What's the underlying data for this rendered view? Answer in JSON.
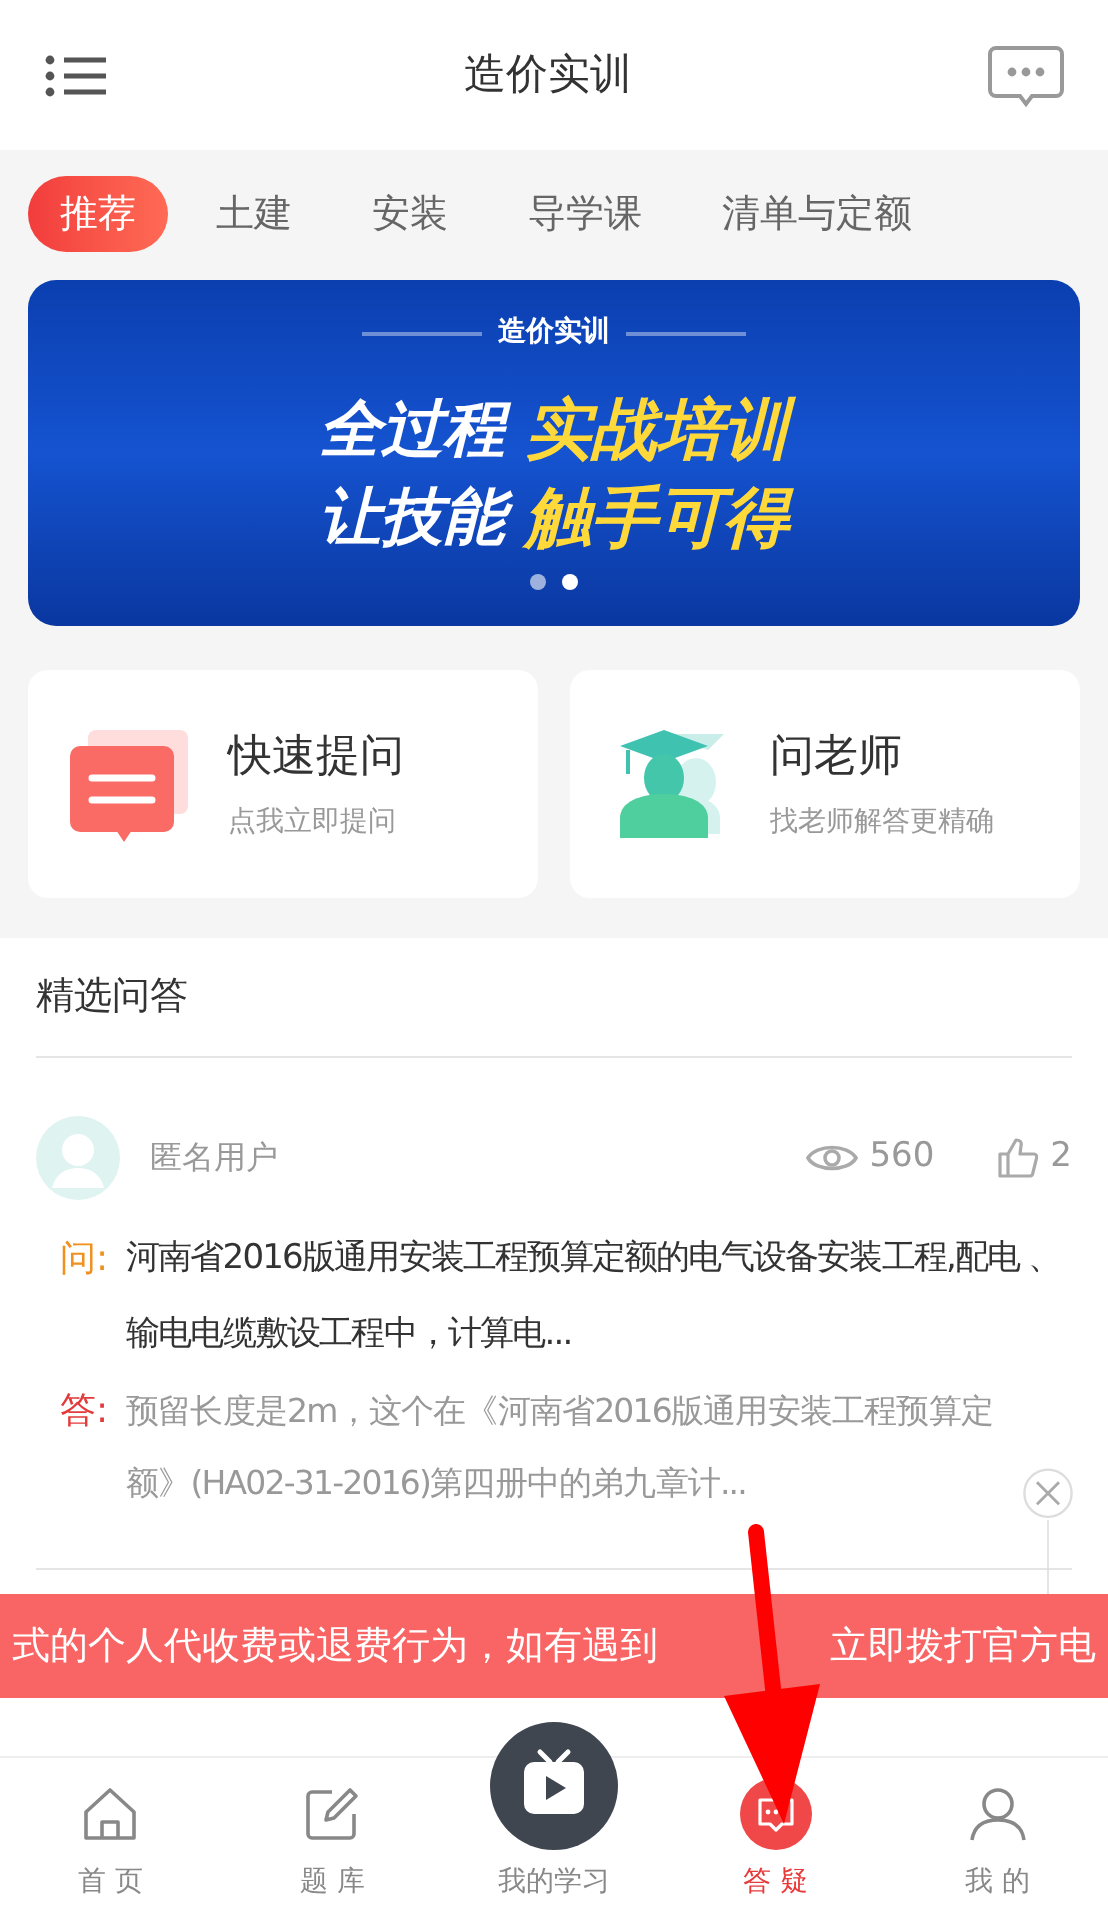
{
  "header": {
    "title": "造价实训"
  },
  "tabs": [
    {
      "label": "推荐",
      "selected": true
    },
    {
      "label": "土建",
      "selected": false
    },
    {
      "label": "安装",
      "selected": false
    },
    {
      "label": "导学课",
      "selected": false
    },
    {
      "label": "清单与定额",
      "selected": false
    }
  ],
  "banner": {
    "kicker": "造价实训",
    "line1_white": "全过程",
    "line1_yellow": "实战培训",
    "line2_white": "让技能",
    "line2_yellow": "触手可得",
    "dots": [
      {
        "selected": false
      },
      {
        "selected": true
      }
    ]
  },
  "quick_cards": [
    {
      "kind": "ask",
      "title": "快速提问",
      "subtitle": "点我立即提问"
    },
    {
      "kind": "teacher",
      "title": "问老师",
      "subtitle": "找老师解答更精确"
    }
  ],
  "featured": {
    "title": "精选问答",
    "items": [
      {
        "user": "匿名用户",
        "views": "560",
        "likes": "2",
        "q_label": "问:",
        "question": "河南省2016版通用安装工程预算定额的电气设备安装工程,配电 、输电电缆敷设工程中，计算电...",
        "a_label": "答:",
        "answer": "预留长度是2m，这个在《河南省2016版通用安装工程预算定额》(HA02-31-2016)第四册中的弟九章计..."
      }
    ]
  },
  "notice": {
    "text_left": "式的个人代收费或退费行为，如有遇到",
    "text_right": "立即拨打官方电"
  },
  "bottom_nav": [
    {
      "kind": "home",
      "label": "首 页",
      "selected": false
    },
    {
      "kind": "edit",
      "label": "题 库",
      "selected": false
    },
    {
      "kind": "center",
      "label": "我的学习",
      "selected": false
    },
    {
      "kind": "chat",
      "label": "答 疑",
      "selected": true
    },
    {
      "kind": "user",
      "label": "我 的",
      "selected": false
    }
  ]
}
